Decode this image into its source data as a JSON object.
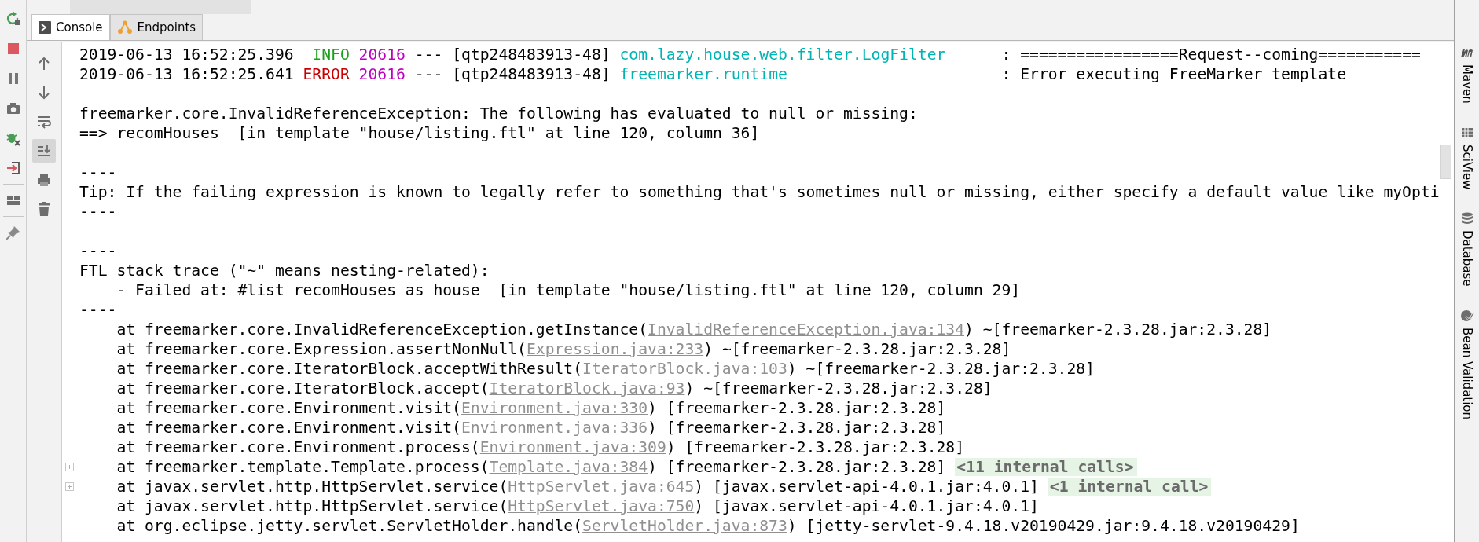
{
  "run_toolbar": [
    {
      "kind": "rerun"
    },
    {
      "kind": "stop"
    },
    {
      "kind": "pause"
    },
    {
      "kind": "camera"
    },
    {
      "kind": "debug"
    },
    {
      "kind": "exit"
    },
    {
      "kind": "layout"
    },
    {
      "kind": "pin"
    }
  ],
  "tabs": [
    {
      "label": "Console",
      "kind": "console",
      "selected": true
    },
    {
      "label": "Endpoints",
      "kind": "endpoints",
      "selected": false
    }
  ],
  "console_toolbar": [
    {
      "kind": "up",
      "selected": false
    },
    {
      "kind": "down",
      "selected": false
    },
    {
      "kind": "wrap",
      "selected": false
    },
    {
      "kind": "scroll_end",
      "selected": true
    },
    {
      "kind": "print",
      "selected": false
    },
    {
      "kind": "trash",
      "selected": false
    }
  ],
  "console_lines": [
    {
      "kind": "text",
      "segments": [
        {
          "kind": "plain",
          "text": "2019-06-13 16:52:25.396  "
        },
        {
          "kind": "info",
          "text": "INFO"
        },
        {
          "kind": "pid",
          "text": " 20616"
        },
        {
          "kind": "plain",
          "text": " --- [qtp248483913-48] "
        },
        {
          "kind": "logger",
          "text": "com.lazy.house.web.filter.LogFilter"
        },
        {
          "kind": "plain",
          "text": "      : =================Request--coming==========="
        }
      ]
    },
    {
      "kind": "text",
      "segments": [
        {
          "kind": "plain",
          "text": "2019-06-13 16:52:25.641 "
        },
        {
          "kind": "error",
          "text": "ERROR"
        },
        {
          "kind": "pid",
          "text": " 20616"
        },
        {
          "kind": "plain",
          "text": " --- [qtp248483913-48] "
        },
        {
          "kind": "logger",
          "text": "freemarker.runtime"
        },
        {
          "kind": "plain",
          "text": "                       : Error executing FreeMarker template"
        }
      ]
    },
    {
      "kind": "blank"
    },
    {
      "kind": "text",
      "segments": [
        {
          "kind": "plain",
          "text": "freemarker.core.InvalidReferenceException: The following has evaluated to null or missing:"
        }
      ]
    },
    {
      "kind": "text",
      "segments": [
        {
          "kind": "plain",
          "text": "==> recomHouses  [in template \"house/listing.ftl\" at line 120, column 36]"
        }
      ]
    },
    {
      "kind": "blank"
    },
    {
      "kind": "text",
      "segments": [
        {
          "kind": "plain",
          "text": "----"
        }
      ]
    },
    {
      "kind": "text",
      "segments": [
        {
          "kind": "plain",
          "text": "Tip: If the failing expression is known to legally refer to something that's sometimes null or missing, either specify a default value like myOpti"
        }
      ]
    },
    {
      "kind": "text",
      "segments": [
        {
          "kind": "plain",
          "text": "----"
        }
      ]
    },
    {
      "kind": "blank"
    },
    {
      "kind": "text",
      "segments": [
        {
          "kind": "plain",
          "text": "----"
        }
      ]
    },
    {
      "kind": "text",
      "segments": [
        {
          "kind": "plain",
          "text": "FTL stack trace (\"~\" means nesting-related):"
        }
      ]
    },
    {
      "kind": "text",
      "segments": [
        {
          "kind": "plain",
          "text": "    - Failed at: #list recomHouses as house  [in template \"house/listing.ftl\" at line 120, column 29]"
        }
      ]
    },
    {
      "kind": "text",
      "segments": [
        {
          "kind": "plain",
          "text": "----"
        }
      ]
    },
    {
      "kind": "text",
      "segments": [
        {
          "kind": "plain",
          "text": "    at freemarker.core.InvalidReferenceException.getInstance("
        },
        {
          "kind": "link",
          "text": "InvalidReferenceException.java:134"
        },
        {
          "kind": "plain",
          "text": ") ~[freemarker-2.3.28.jar:2.3.28]"
        }
      ]
    },
    {
      "kind": "text",
      "segments": [
        {
          "kind": "plain",
          "text": "    at freemarker.core.Expression.assertNonNull("
        },
        {
          "kind": "link",
          "text": "Expression.java:233"
        },
        {
          "kind": "plain",
          "text": ") ~[freemarker-2.3.28.jar:2.3.28]"
        }
      ]
    },
    {
      "kind": "text",
      "segments": [
        {
          "kind": "plain",
          "text": "    at freemarker.core.IteratorBlock.acceptWithResult("
        },
        {
          "kind": "link",
          "text": "IteratorBlock.java:103"
        },
        {
          "kind": "plain",
          "text": ") ~[freemarker-2.3.28.jar:2.3.28]"
        }
      ]
    },
    {
      "kind": "text",
      "segments": [
        {
          "kind": "plain",
          "text": "    at freemarker.core.IteratorBlock.accept("
        },
        {
          "kind": "link",
          "text": "IteratorBlock.java:93"
        },
        {
          "kind": "plain",
          "text": ") ~[freemarker-2.3.28.jar:2.3.28]"
        }
      ]
    },
    {
      "kind": "text",
      "segments": [
        {
          "kind": "plain",
          "text": "    at freemarker.core.Environment.visit("
        },
        {
          "kind": "link",
          "text": "Environment.java:330"
        },
        {
          "kind": "plain",
          "text": ") [freemarker-2.3.28.jar:2.3.28]"
        }
      ]
    },
    {
      "kind": "text",
      "segments": [
        {
          "kind": "plain",
          "text": "    at freemarker.core.Environment.visit("
        },
        {
          "kind": "link",
          "text": "Environment.java:336"
        },
        {
          "kind": "plain",
          "text": ") [freemarker-2.3.28.jar:2.3.28]"
        }
      ]
    },
    {
      "kind": "text",
      "segments": [
        {
          "kind": "plain",
          "text": "    at freemarker.core.Environment.process("
        },
        {
          "kind": "link",
          "text": "Environment.java:309"
        },
        {
          "kind": "plain",
          "text": ") [freemarker-2.3.28.jar:2.3.28]"
        }
      ]
    },
    {
      "kind": "text",
      "fold": "<11 internal calls>",
      "segments": [
        {
          "kind": "plain",
          "text": "    at freemarker.template.Template.process("
        },
        {
          "kind": "link",
          "text": "Template.java:384"
        },
        {
          "kind": "plain",
          "text": ") [freemarker-2.3.28.jar:2.3.28]"
        }
      ]
    },
    {
      "kind": "text",
      "fold": "<1 internal call>",
      "segments": [
        {
          "kind": "plain",
          "text": "    at javax.servlet.http.HttpServlet.service("
        },
        {
          "kind": "link",
          "text": "HttpServlet.java:645"
        },
        {
          "kind": "plain",
          "text": ") [javax.servlet-api-4.0.1.jar:4.0.1]"
        }
      ]
    },
    {
      "kind": "text",
      "segments": [
        {
          "kind": "plain",
          "text": "    at javax.servlet.http.HttpServlet.service("
        },
        {
          "kind": "link",
          "text": "HttpServlet.java:750"
        },
        {
          "kind": "plain",
          "text": ") [javax.servlet-api-4.0.1.jar:4.0.1]"
        }
      ]
    },
    {
      "kind": "text",
      "segments": [
        {
          "kind": "plain",
          "text": "    at org.eclipse.jetty.servlet.ServletHolder.handle("
        },
        {
          "kind": "link",
          "text": "ServletHolder.java:873"
        },
        {
          "kind": "plain",
          "text": ") [jetty-servlet-9.4.18.v20190429.jar:9.4.18.v20190429]"
        }
      ]
    }
  ],
  "tool_windows": [
    {
      "label": "Maven",
      "kind": "maven"
    },
    {
      "label": "SciView",
      "kind": "sciview"
    },
    {
      "label": "Database",
      "kind": "database"
    },
    {
      "label": "Bean Validation",
      "kind": "bean"
    }
  ]
}
